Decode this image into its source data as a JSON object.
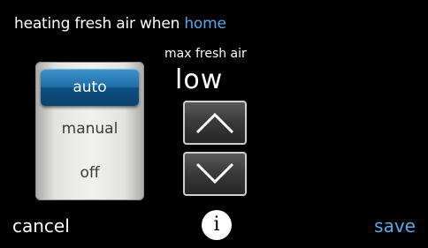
{
  "header": {
    "title_prefix": "heating fresh air when ",
    "title_accent": "home"
  },
  "mode": {
    "options": [
      {
        "label": "auto",
        "selected": true
      },
      {
        "label": "manual",
        "selected": false
      },
      {
        "label": "off",
        "selected": false
      }
    ]
  },
  "fresh_air": {
    "label": "max fresh air",
    "value": "low"
  },
  "footer": {
    "cancel_label": "cancel",
    "info_label": "i",
    "save_label": "save"
  },
  "colors": {
    "accent": "#5aa8e8",
    "selected_option": "#1f6ea8",
    "background": "#000000"
  },
  "icons": {
    "up": "chevron-up-icon",
    "down": "chevron-down-icon",
    "info": "info-icon"
  }
}
